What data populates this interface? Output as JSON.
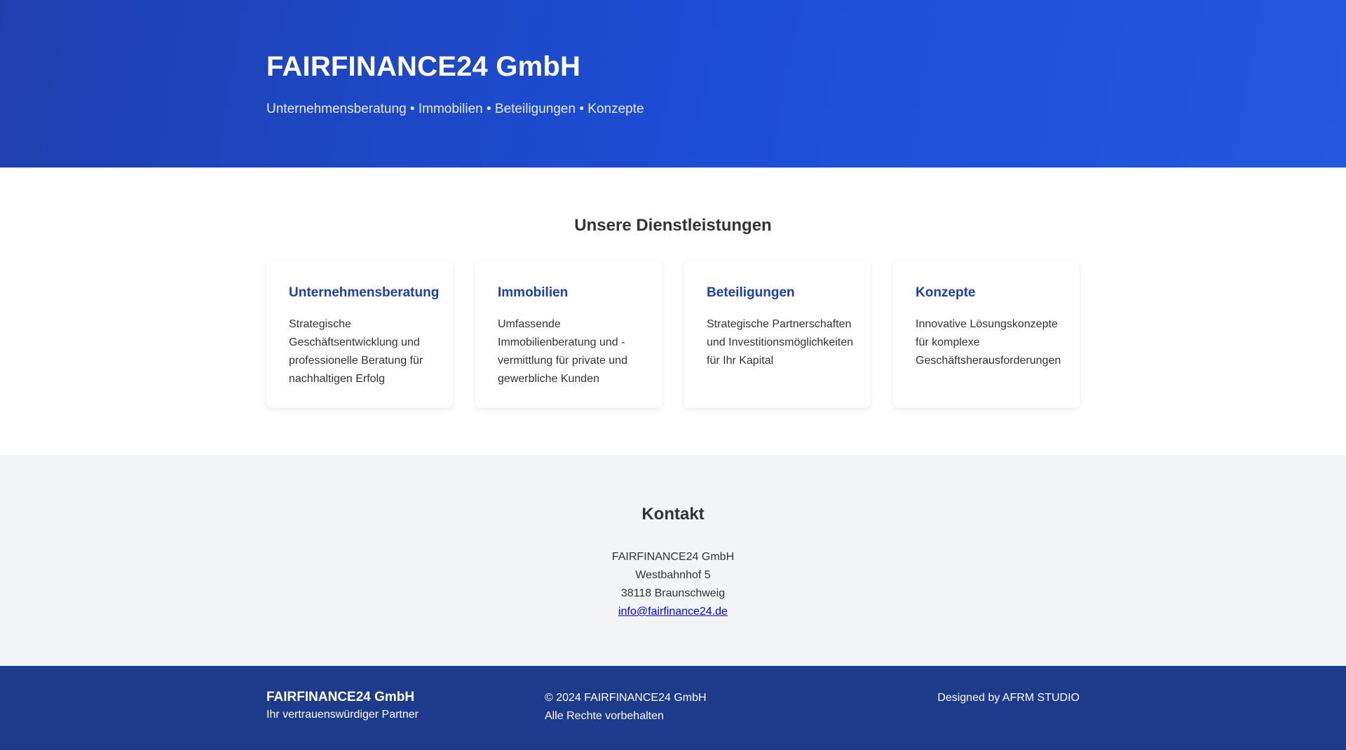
{
  "header": {
    "title": "FAIRFINANCE24 GmbH",
    "tagline": "Unternehmensberatung • Immobilien • Beteiligungen • Konzepte"
  },
  "services": {
    "heading": "Unsere Dienstleistungen",
    "cards": [
      {
        "title": "Unternehmensberatung",
        "text": "Strategische Geschäftsentwicklung und professionelle Beratung für nachhaltigen Erfolg"
      },
      {
        "title": "Immobilien",
        "text": "Umfassende Immobilienberatung und -vermittlung für private und gewerbliche Kunden"
      },
      {
        "title": "Beteiligungen",
        "text": "Strategische Partnerschaften und Investitionsmöglichkeiten für Ihr Kapital"
      },
      {
        "title": "Konzepte",
        "text": "Innovative Lösungskonzepte für komplexe Geschäftsherausforderungen"
      }
    ]
  },
  "contact": {
    "heading": "Kontakt",
    "company": "FAIRFINANCE24 GmbH",
    "street": "Westbahnhof 5",
    "city": "38118 Braunschweig",
    "email": "info@fairfinance24.de"
  },
  "footer": {
    "brand": "FAIRFINANCE24 GmbH",
    "slogan": "Ihr vertrauenswürdiger Partner",
    "copyright": "© 2024 FAIRFINANCE24 GmbH",
    "rights": "Alle Rechte vorbehalten",
    "designed_by": "Designed by AFRM STUDIO"
  },
  "colors": {
    "primary": "#1e40af",
    "footer_bg": "#1e3a8a",
    "contact_bg": "#f3f4f6",
    "text": "#333333",
    "link": "#0000ee"
  }
}
